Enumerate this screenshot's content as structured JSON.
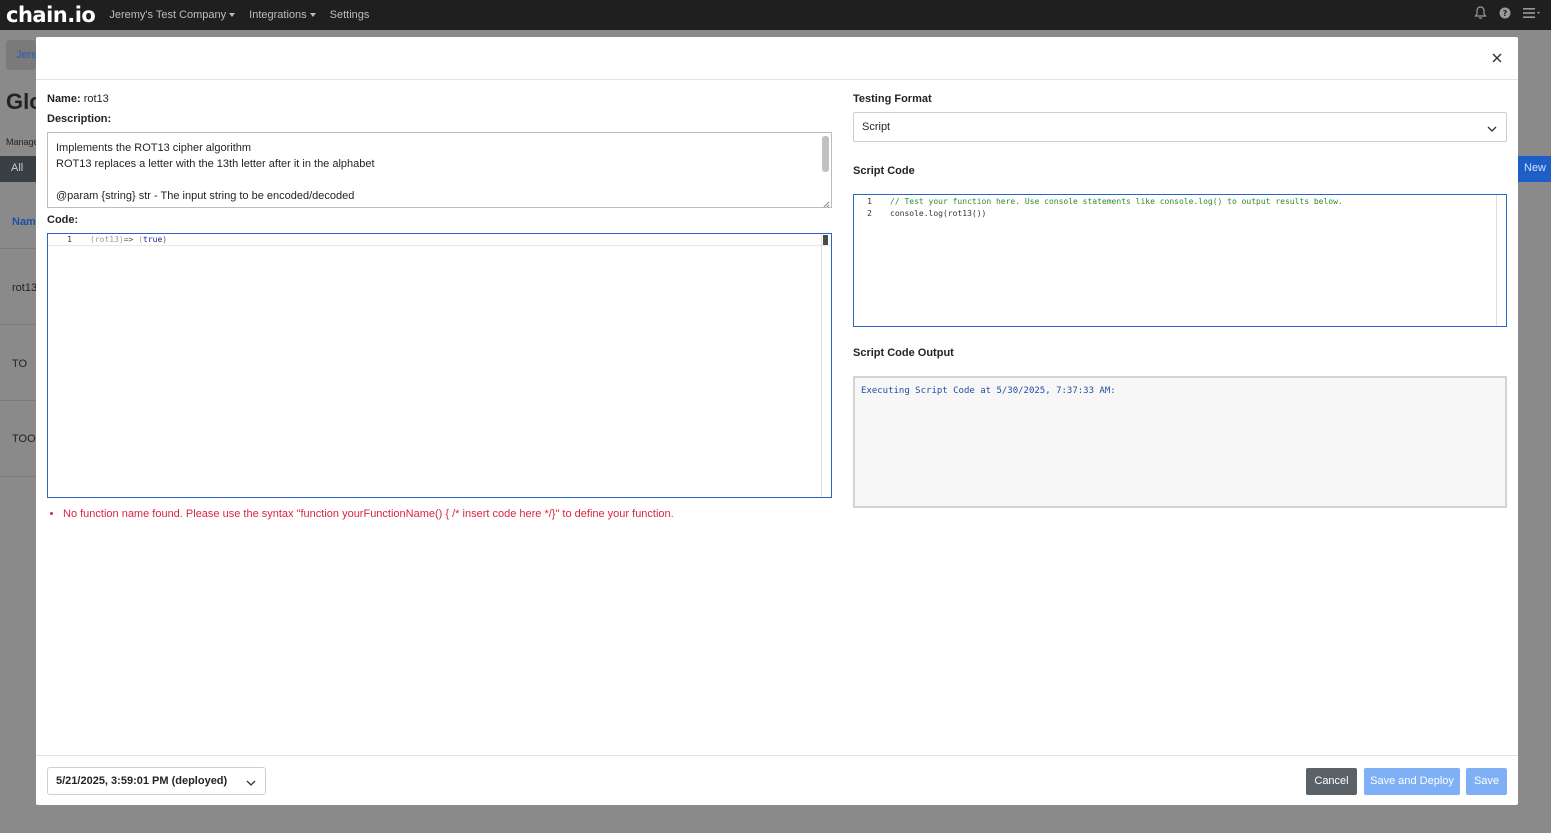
{
  "topnav": {
    "brand": "chain.io",
    "items": [
      {
        "label": "Jeremy's Test Company",
        "has_caret": true
      },
      {
        "label": "Integrations",
        "has_caret": true
      },
      {
        "label": "Settings",
        "has_caret": false
      }
    ],
    "right_icons": [
      "bell-icon",
      "help-icon",
      "menu-icon"
    ]
  },
  "background": {
    "breadcrumb": "Jere",
    "title": "Glo",
    "manage": "Manage",
    "all_tab": "All",
    "name_header": "Nam",
    "rows": [
      "rot13",
      "TO",
      "TOO"
    ],
    "new_button": "New"
  },
  "modal": {
    "close_icon": "close-icon",
    "left": {
      "name_label": "Name:",
      "name_value": "rot13",
      "description_label": "Description:",
      "description_lines": [
        "Implements the ROT13 cipher algorithm",
        "ROT13 replaces a letter with the 13th letter after it in the alphabet",
        "",
        "@param {string} str - The input string to be encoded/decoded"
      ],
      "code_label": "Code:",
      "code_lines": [
        {
          "n": "1",
          "open": "(rot13)",
          "arrow": "=>",
          "body_open": "(",
          "body": "true",
          "body_close": ")"
        }
      ],
      "error": "No function name found. Please use the syntax \"function yourFunctionName() { /* insert code here */}\" to define your function."
    },
    "right": {
      "testing_format_label": "Testing Format",
      "testing_format_value": "Script",
      "script_code_label": "Script Code",
      "script_lines": [
        {
          "n": "1",
          "text": "// Test your function here. Use console statements like console.log() to output results below."
        },
        {
          "n": "2",
          "text": "console.log(rot13())"
        }
      ],
      "output_label": "Script Code Output",
      "output_text": "Executing Script Code at 5/30/2025, 7:37:33 AM:"
    },
    "footer": {
      "version_value": "5/21/2025, 3:59:01 PM (deployed)",
      "cancel_label": "Cancel",
      "save_deploy_label": "Save and Deploy",
      "save_label": "Save"
    }
  }
}
